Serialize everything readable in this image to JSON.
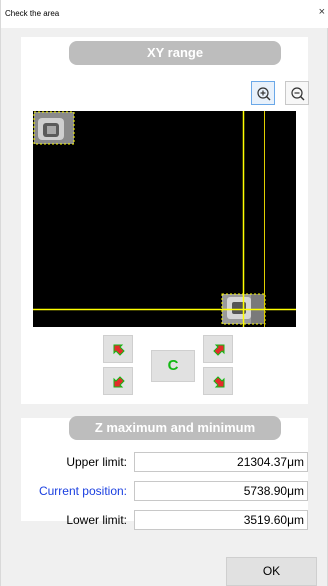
{
  "window": {
    "title": "Check the area",
    "close_glyph": "×"
  },
  "xy_section": {
    "header": "XY range",
    "zoom_in_icon": "zoom-in-icon",
    "zoom_out_icon": "zoom-out-icon",
    "nav": {
      "center_label": "C",
      "arrow_color": "#e52b2b",
      "arrow_outline": "#14b814"
    }
  },
  "z_section": {
    "header": "Z maximum and minimum",
    "upper_label": "Upper limit:",
    "upper_value": "21304.37μm",
    "current_label": "Current position:",
    "current_value": "5738.90μm",
    "lower_label": "Lower limit:",
    "lower_value": "3519.60μm"
  },
  "footer": {
    "ok_label": "OK"
  },
  "colors": {
    "crosshair": "#ffff00",
    "canvas_bg": "#000000",
    "current_position_label": "#1a3fe0"
  }
}
